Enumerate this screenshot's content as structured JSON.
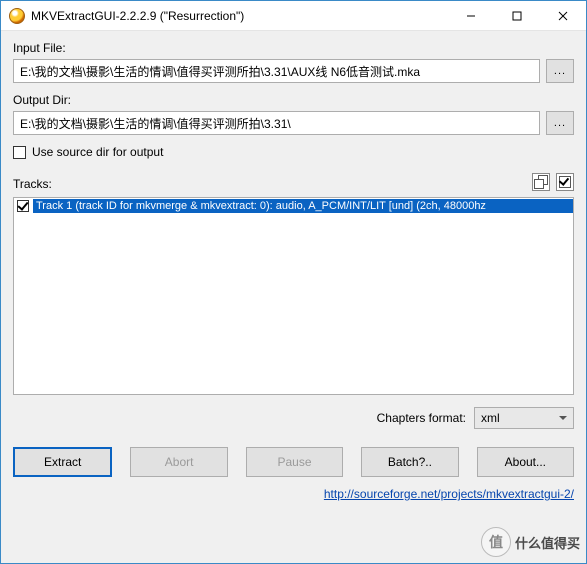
{
  "window": {
    "title": "MKVExtractGUI-2.2.2.9 (\"Resurrection\")"
  },
  "labels": {
    "input_file": "Input File:",
    "output_dir": "Output Dir:",
    "use_source_dir": "Use source dir for output",
    "tracks": "Tracks:",
    "chapters_format": "Chapters format:"
  },
  "fields": {
    "input_file_value": "E:\\我的文档\\摄影\\生活的情调\\值得买评测所拍\\3.31\\AUX线 N6低音测试.mka",
    "output_dir_value": "E:\\我的文档\\摄影\\生活的情调\\值得买评测所拍\\3.31\\",
    "chapters_format_value": "xml"
  },
  "tracks": [
    {
      "checked": true,
      "text": "Track 1 (track ID for mkvmerge & mkvextract: 0): audio, A_PCM/INT/LIT [und]  (2ch, 48000hz"
    }
  ],
  "buttons": {
    "extract": "Extract",
    "abort": "Abort",
    "pause": "Pause",
    "batch": "Batch?..",
    "about": "About...",
    "browse": "..."
  },
  "footer": {
    "link_text": "http://sourceforge.net/projects/mkvextractgui-2/"
  },
  "watermark": {
    "glyph": "值",
    "text": "什么值得买"
  }
}
